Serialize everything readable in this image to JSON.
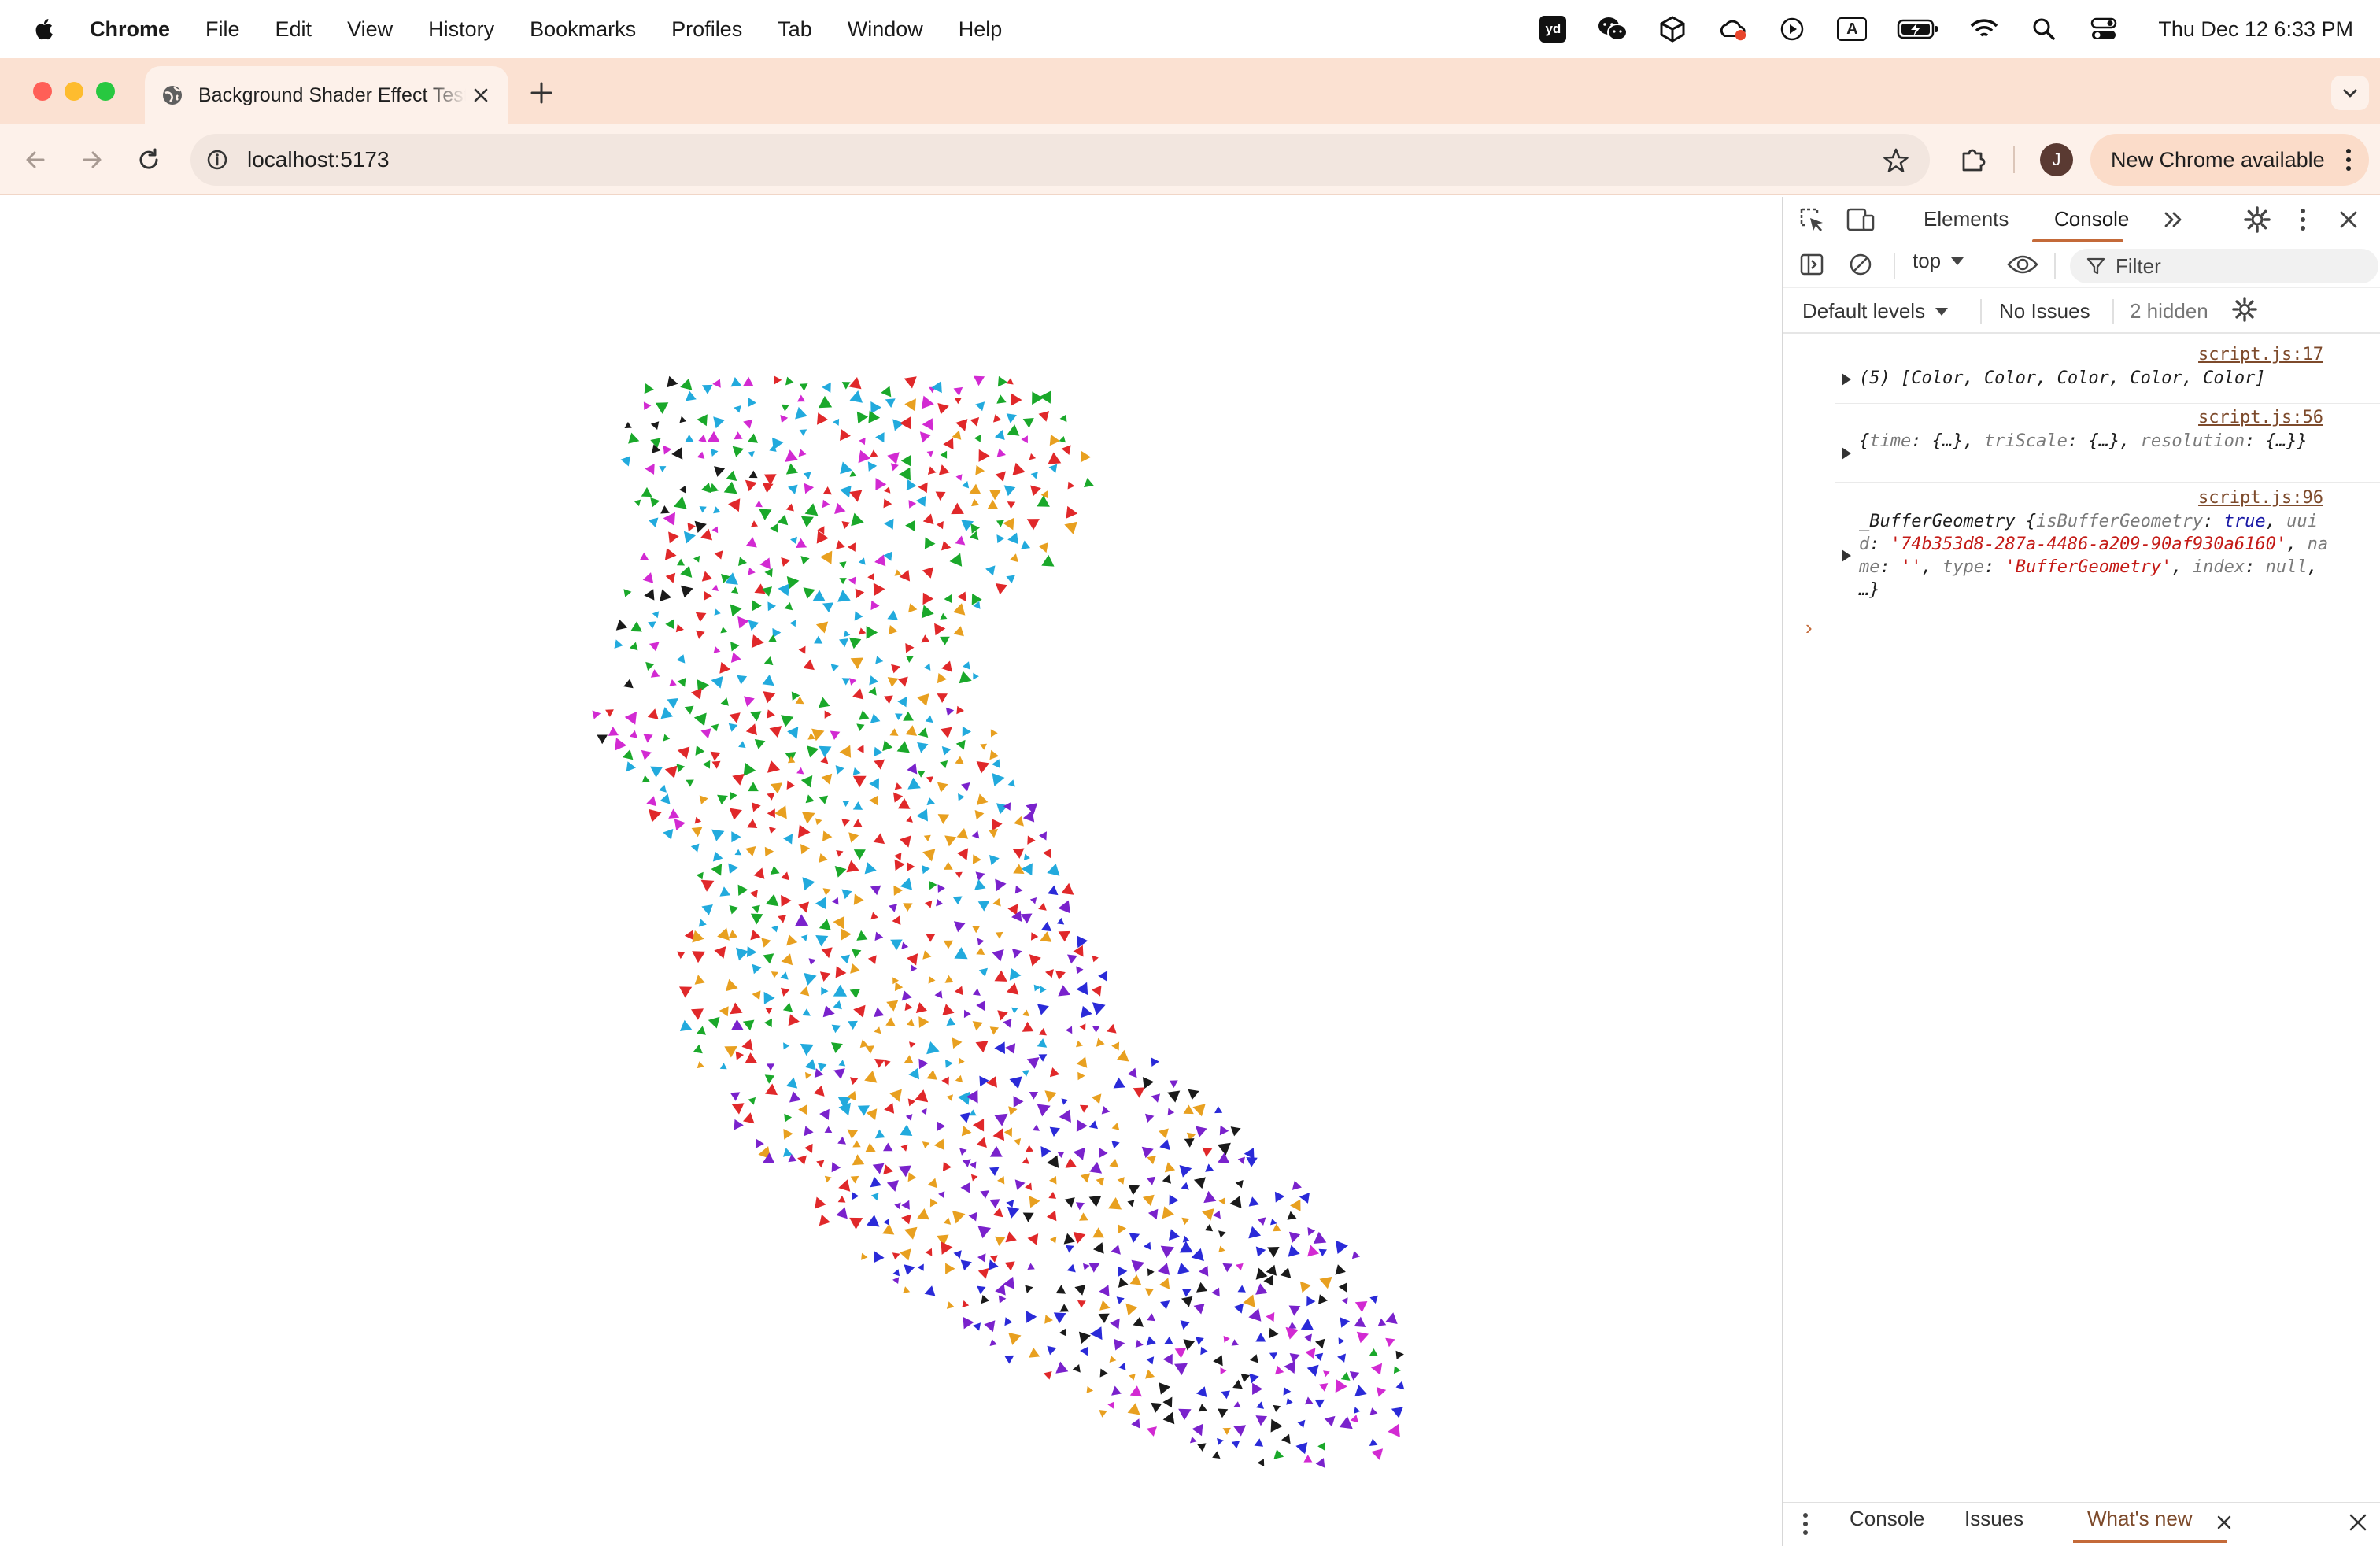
{
  "menubar": {
    "app": "Chrome",
    "items": [
      "File",
      "Edit",
      "View",
      "History",
      "Bookmarks",
      "Profiles",
      "Tab",
      "Window",
      "Help"
    ],
    "tray_icons": [
      "youdao-icon",
      "wechat-icon",
      "unity-icon",
      "creative-cloud-icon",
      "play-icon",
      "input-source-icon",
      "battery-icon",
      "wifi-icon",
      "spotlight-icon",
      "control-center-icon"
    ],
    "input_source": "A",
    "tray_badge": "yd",
    "clock": "Thu Dec 12  6:33 PM"
  },
  "browser": {
    "tab_title": "Background Shader Effect Test",
    "url": "localhost:5173",
    "profile_initial": "J",
    "update_label": "New Chrome available",
    "accent": "#fbe1d2"
  },
  "devtools": {
    "tabs": [
      "Elements",
      "Console"
    ],
    "context": "top",
    "filter_placeholder": "Filter",
    "levels": "Default levels",
    "issues": "No Issues",
    "hidden": "2 hidden",
    "logs": [
      {
        "source": "script.js:17",
        "parts": [
          [
            "",
            "(5) [Color, Color, Color, Color, Color]"
          ]
        ]
      },
      {
        "source": "script.js:56",
        "parts": [
          [
            "",
            "{"
          ],
          [
            "key",
            "time"
          ],
          [
            "",
            ": {…}, "
          ],
          [
            "key",
            "triScale"
          ],
          [
            "",
            ": {…}, "
          ],
          [
            "key",
            "resolution"
          ],
          [
            "",
            ": {…}}"
          ]
        ]
      },
      {
        "source": "script.js:96",
        "parts": [
          [
            "",
            "_BufferGeometry {"
          ],
          [
            "key",
            "isBufferGeometry"
          ],
          [
            "",
            ": "
          ],
          [
            "kw",
            "true"
          ],
          [
            "",
            ", "
          ],
          [
            "key",
            "uuid"
          ],
          [
            "",
            ": "
          ],
          [
            "str",
            "'74b353d8-287a-4486-a209-90af930a6160'"
          ],
          [
            "",
            ", "
          ],
          [
            "key",
            "name"
          ],
          [
            "",
            ": "
          ],
          [
            "str",
            "''"
          ],
          [
            "",
            ", "
          ],
          [
            "key",
            "type"
          ],
          [
            "",
            ": "
          ],
          [
            "str",
            "'BufferGeometry'"
          ],
          [
            "",
            ", "
          ],
          [
            "key",
            "index"
          ],
          [
            "",
            ": "
          ],
          [
            "nul",
            "null"
          ],
          [
            "",
            ", …}"
          ]
        ]
      }
    ],
    "prompt": "›",
    "drawer_tabs": [
      "Console",
      "Issues",
      "What's new"
    ]
  },
  "scene": {
    "description_colors": [
      "#e0282a",
      "#1aa82a",
      "#2a2ad8",
      "#d22ad2",
      "#1a1a1a",
      "#22aadd",
      "#e8a020"
    ]
  }
}
